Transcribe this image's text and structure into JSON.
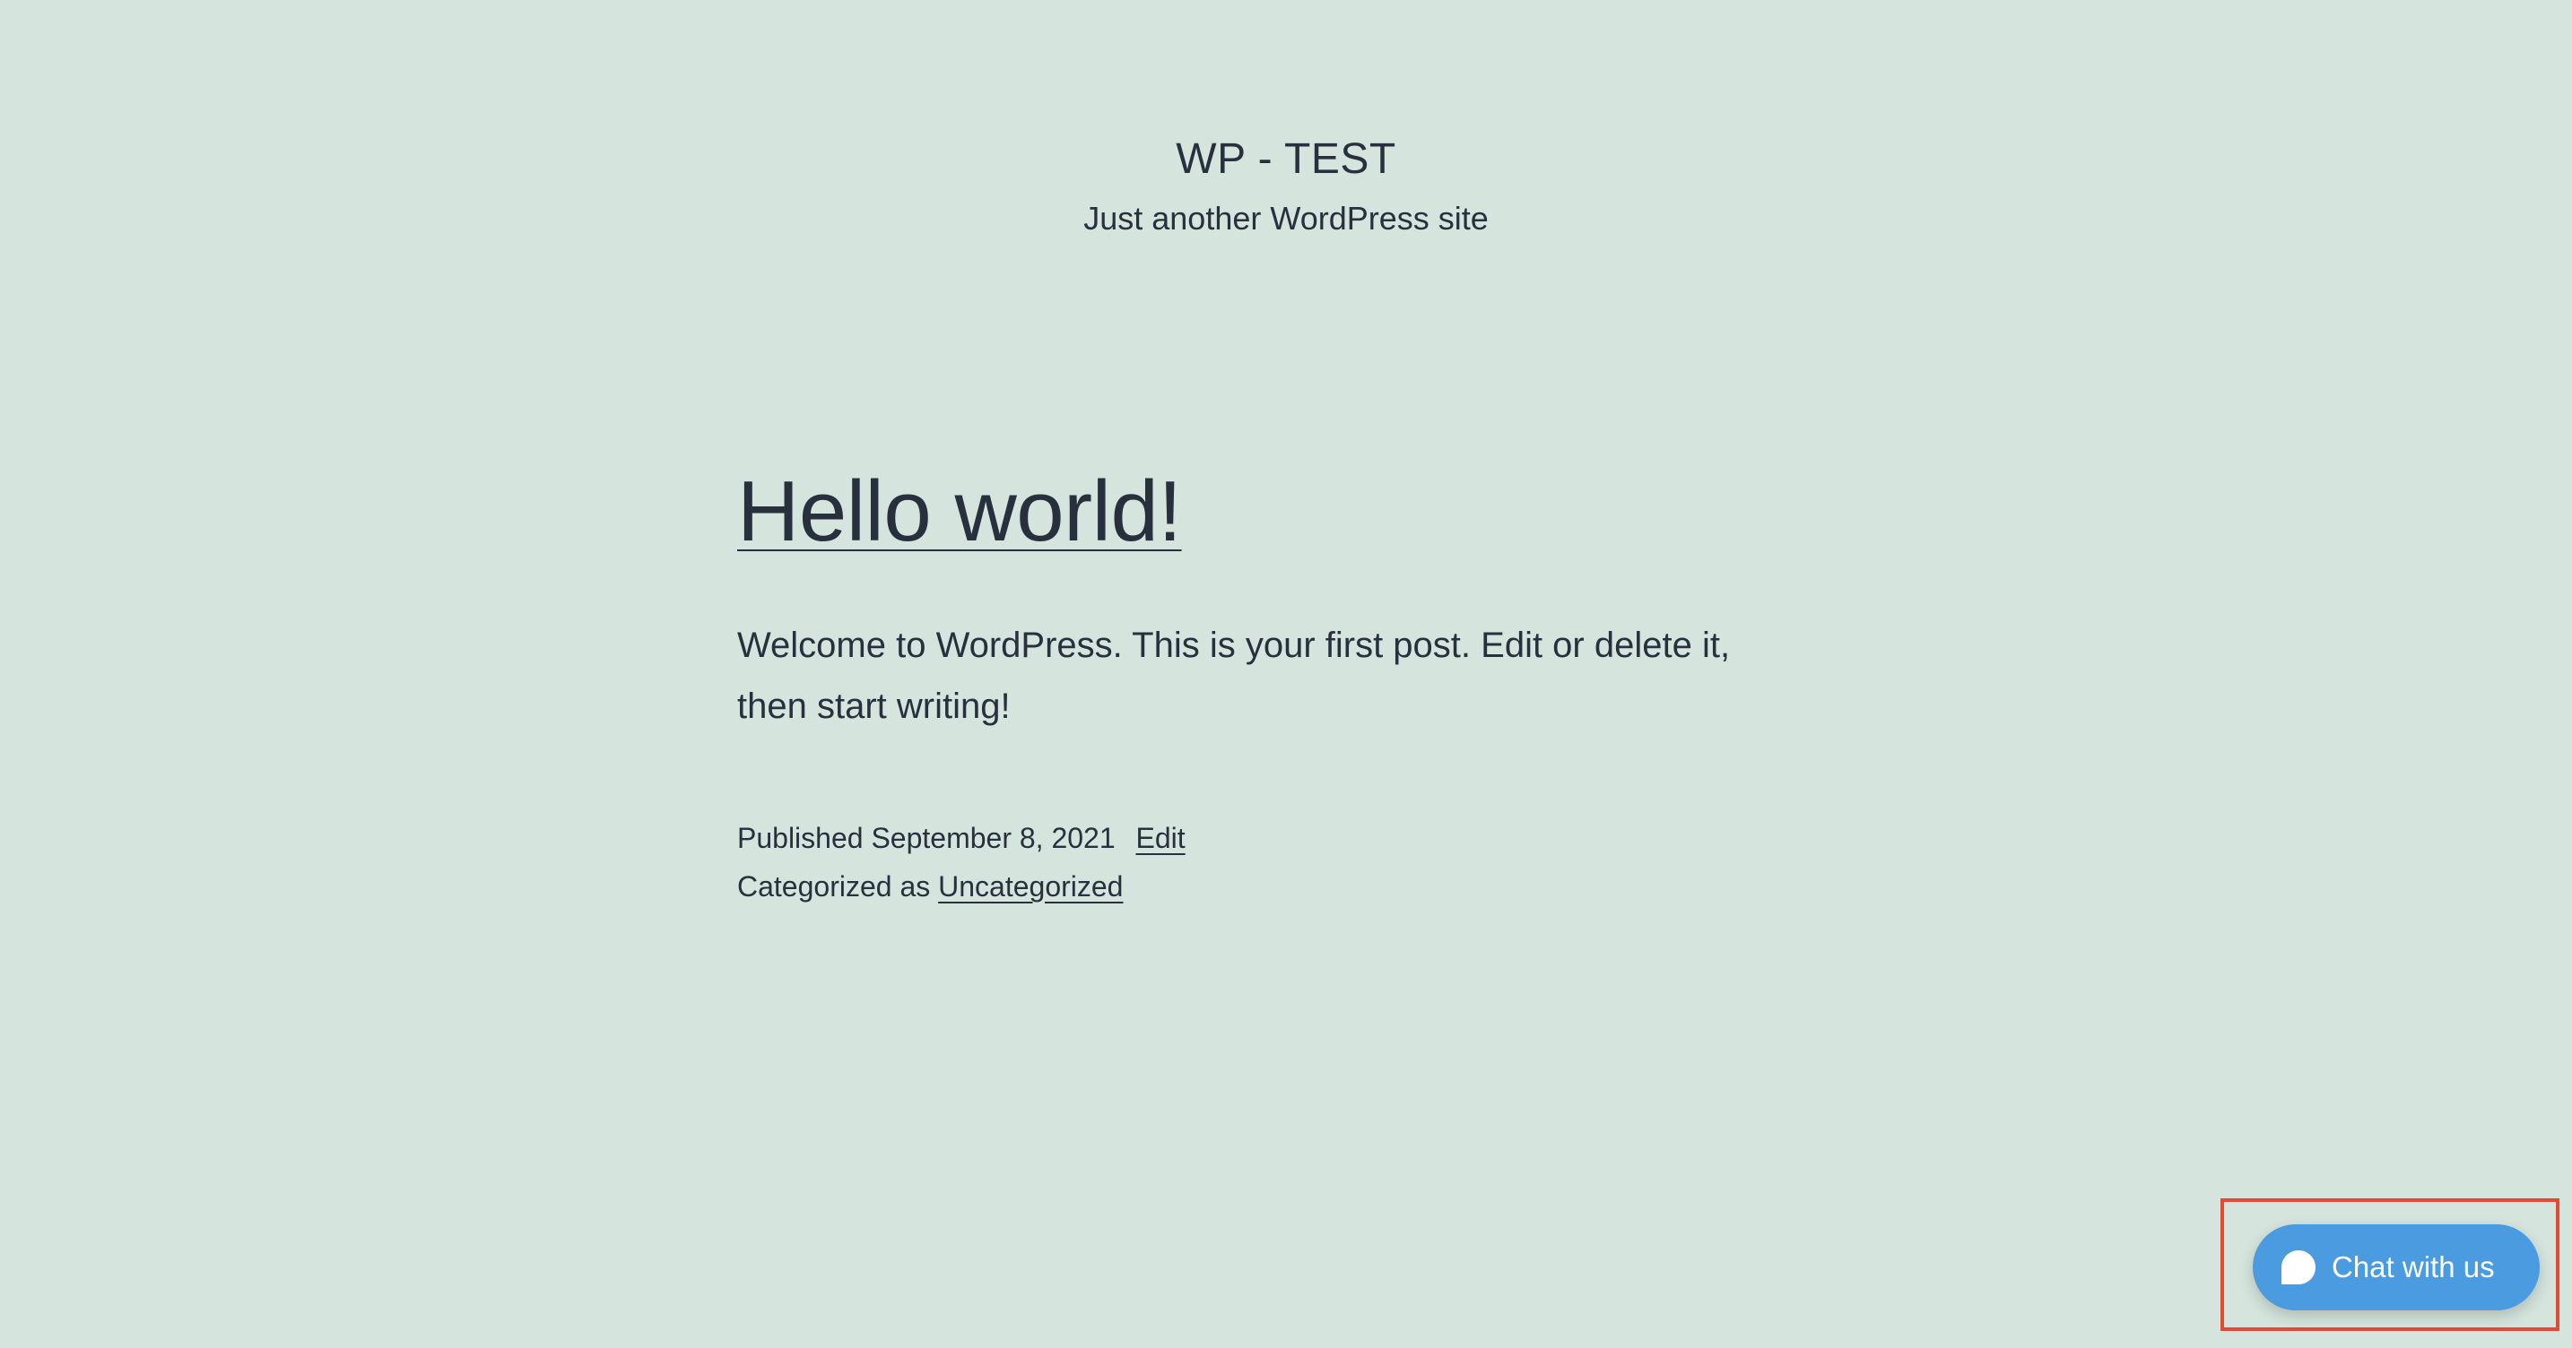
{
  "site": {
    "title": "WP - TEST",
    "tagline": "Just another WordPress site"
  },
  "post": {
    "title": "Hello world!",
    "content": "Welcome to WordPress. This is your first post. Edit or delete it, then start writing!",
    "published_label": "Published",
    "published_date": "September 8, 2021",
    "edit_link": "Edit",
    "categorized_label": "Categorized as",
    "category_link": "Uncategorized"
  },
  "chat_widget": {
    "label": "Chat with us",
    "icon": "chat-bubble-icon",
    "background_color": "#4a9be0",
    "highlight_color": "#e04b32"
  },
  "colors": {
    "page_background": "#d5e4dd",
    "text": "#28303d"
  }
}
